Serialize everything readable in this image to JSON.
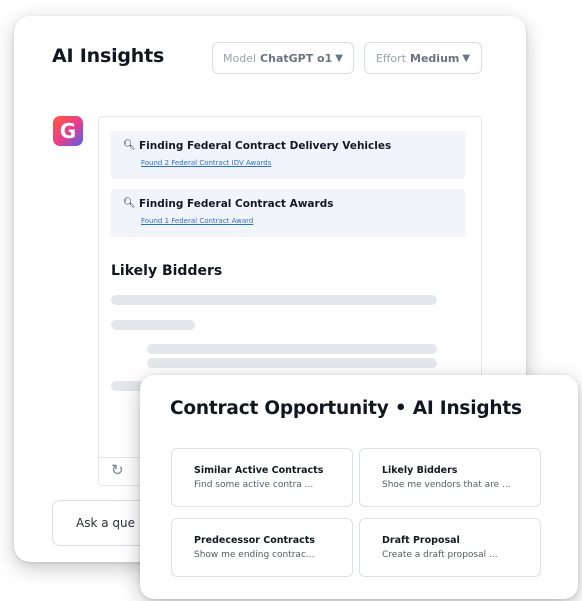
{
  "insights": {
    "title": "AI Insights",
    "model": {
      "label": "Model",
      "value": "ChatGPT o1"
    },
    "effort": {
      "label": "Effort",
      "value": "Medium"
    },
    "avatar_letter": "G",
    "findings": [
      {
        "title": "Finding Federal Contract Delivery Vehicles",
        "link": "Found 2 Federal Contract IDV Awards"
      },
      {
        "title": "Finding Federal Contract Awards",
        "link": "Found 1 Federal Contract Award"
      }
    ],
    "section_heading": "Likely Bidders",
    "ask_placeholder": "Ask a que"
  },
  "opportunity": {
    "title": "Contract Opportunity • AI Insights",
    "tiles": [
      {
        "title": "Similar Active Contracts",
        "desc": "Find some active contra ..."
      },
      {
        "title": "Likely Bidders",
        "desc": "Shoe me vendors that are ..."
      },
      {
        "title": "Predecessor Contracts",
        "desc": "Show me ending contrac..."
      },
      {
        "title": "Draft Proposal",
        "desc": "Create a draft proposal ..."
      }
    ]
  },
  "icons": {
    "search": "search-icon",
    "refresh": "refresh-icon",
    "caret": "caret-down-icon"
  },
  "colors": {
    "link": "#2b6fd6",
    "finding_bg": "#f1f5fb",
    "skeleton": "#e4e7ec",
    "avatar_gradient": [
      "#ff5a3c",
      "#e53d8f",
      "#4a64f0"
    ]
  }
}
